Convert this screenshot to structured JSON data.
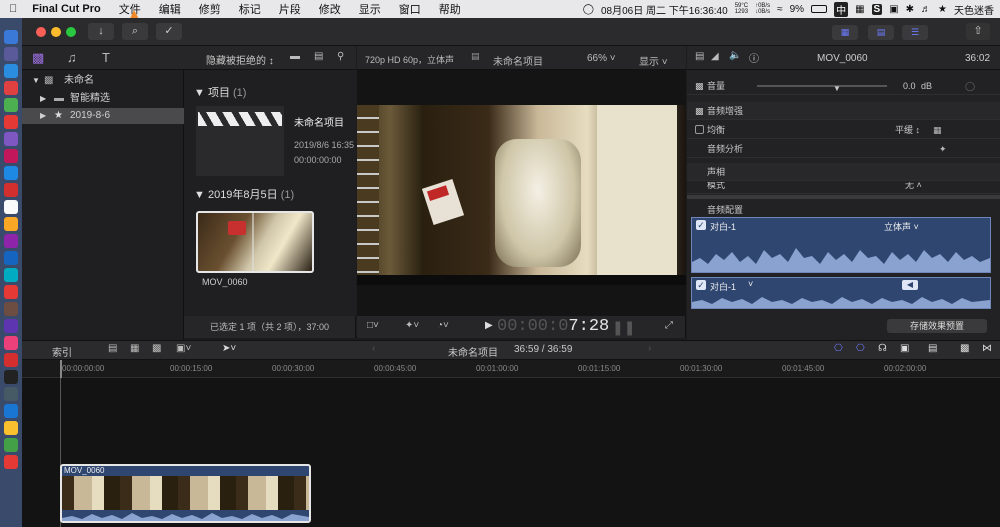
{
  "menubar": {
    "apple_icon": "apple-icon",
    "app_name": "Final Cut Pro",
    "items": [
      "文件",
      "编辑",
      "修剪",
      "标记",
      "片段",
      "修改",
      "显示",
      "窗口",
      "帮助"
    ],
    "clock": "08月06日 周二 下午16:36:40",
    "temperature": "59°C",
    "rpm": "1293",
    "net_up": "0B/s",
    "net_down": "0B/s",
    "battery": "9%",
    "input_method": "中",
    "user": "天色迷香"
  },
  "library": {
    "sort_label": "隐藏被拒绝的",
    "root_name": "未命名",
    "items": [
      {
        "label": "智能精选"
      },
      {
        "label": "2019-8-6"
      }
    ]
  },
  "browser": {
    "section_projects": "项目",
    "projects_count": "(1)",
    "project_name": "未命名项目",
    "project_date": "2019/8/6 16:35",
    "project_duration": "00:00:00:00",
    "section_date": "2019年8月5日",
    "date_count": "(1)",
    "clip_name": "MOV_0060",
    "footer": "已选定 1 项（共 2 项），37:00"
  },
  "viewer": {
    "format": "720p HD 60p，立体声",
    "title": "未命名项目",
    "zoom": "66%",
    "display_label": "显示",
    "timecode_dim": "00:00:0",
    "timecode_bright": "7:28"
  },
  "inspector": {
    "clip_name": "MOV_0060",
    "duration": "36:02",
    "volume_label": "音量",
    "volume_value": "0.0",
    "volume_unit": "dB",
    "audio_enhance": "音频增强",
    "equalization": "均衡",
    "eq_value": "平缓",
    "audio_analysis": "音频分析",
    "pan": "声相",
    "pan_mode": "模式",
    "pan_mode_value": "无",
    "audio_config": "音频配置",
    "channel1_label": "对白-1",
    "channel1_mode": "立体声",
    "channel2_label": "对白-1",
    "save_preset": "存储效果预置"
  },
  "timeline": {
    "index_label": "索引",
    "project": "未命名项目",
    "duration": "36:59 / 36:59",
    "ticks": [
      "00:00:00:00",
      "00:00:15:00",
      "00:00:30:00",
      "00:00:45:00",
      "00:01:00:00",
      "00:01:15:00",
      "00:01:30:00",
      "00:01:45:00",
      "00:02:00:00"
    ],
    "clip_name": "MOV_0060"
  },
  "colors": {
    "accent": "#6e7cff",
    "waveform": "#8aa2cf",
    "arrow": "#f08a2a",
    "clip_bg": "#2e4670"
  }
}
